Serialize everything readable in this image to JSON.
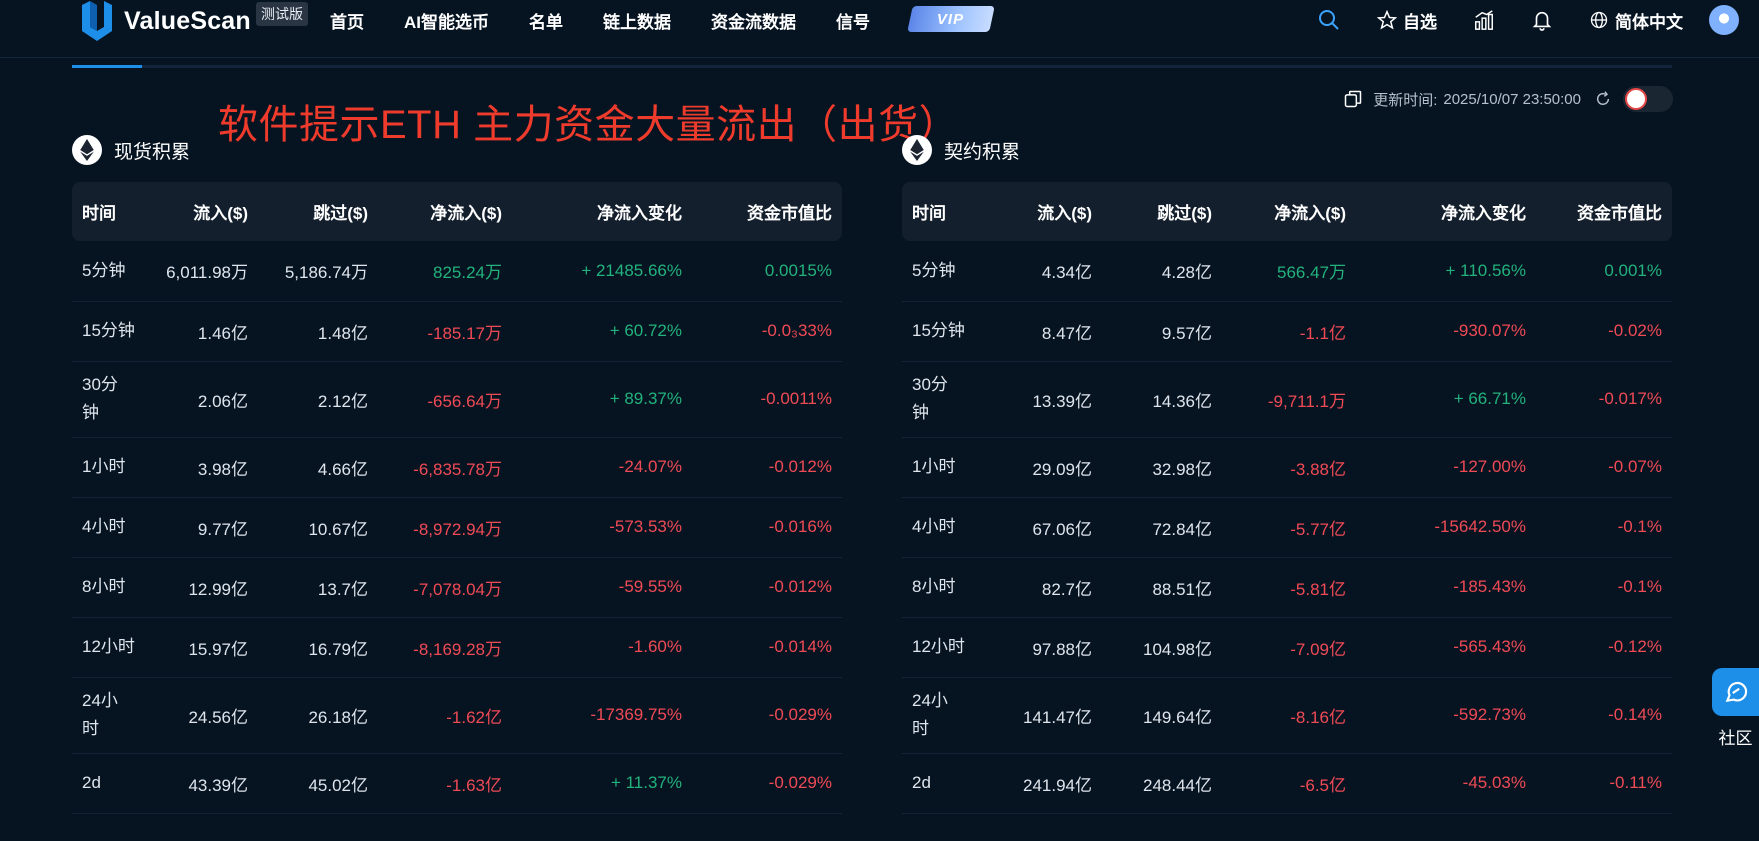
{
  "header": {
    "logo_text": "ValueScan",
    "beta_badge": "测试版",
    "nav": [
      "首页",
      "AI智能选币",
      "名单",
      "链上数据",
      "资金流数据",
      "信号"
    ],
    "vip_label": "VIP",
    "watchlist_label": "自选",
    "language_label": "简体中文"
  },
  "overlay_caption": "软件提示ETH 主力资金大量流出（出货）",
  "update": {
    "label": "更新时间:",
    "time": "2025/10/07 23:50:00"
  },
  "colors": {
    "accent": "#1e8fe8",
    "positive": "#23b27c",
    "negative": "#f04a55",
    "caption": "#ee3b2c"
  },
  "spot": {
    "title": "现货积累",
    "columns": [
      "时间",
      "流入($)",
      "跳过($)",
      "净流入($)",
      "净流入变化",
      "资金市值比"
    ],
    "rows": [
      {
        "period": "5分钟",
        "inflow": "6,011.98万",
        "skip": "5,186.74万",
        "net": "825.24万",
        "change": "+ 21485.66%",
        "ratio": "0.0015%",
        "net_sign": "pos",
        "change_sign": "pos",
        "ratio_sign": "pos"
      },
      {
        "period": "15分钟",
        "inflow": "1.46亿",
        "skip": "1.48亿",
        "net": "-185.17万",
        "change": "+ 60.72%",
        "ratio": "-0.0₃33%",
        "net_sign": "neg",
        "change_sign": "pos",
        "ratio_sign": "neg"
      },
      {
        "period": "30分\n钟",
        "inflow": "2.06亿",
        "skip": "2.12亿",
        "net": "-656.64万",
        "change": "+ 89.37%",
        "ratio": "-0.0011%",
        "net_sign": "neg",
        "change_sign": "pos",
        "ratio_sign": "neg",
        "tall": true
      },
      {
        "period": "1小时",
        "inflow": "3.98亿",
        "skip": "4.66亿",
        "net": "-6,835.78万",
        "change": "-24.07%",
        "ratio": "-0.012%",
        "net_sign": "neg",
        "change_sign": "neg",
        "ratio_sign": "neg"
      },
      {
        "period": "4小时",
        "inflow": "9.77亿",
        "skip": "10.67亿",
        "net": "-8,972.94万",
        "change": "-573.53%",
        "ratio": "-0.016%",
        "net_sign": "neg",
        "change_sign": "neg",
        "ratio_sign": "neg"
      },
      {
        "period": "8小时",
        "inflow": "12.99亿",
        "skip": "13.7亿",
        "net": "-7,078.04万",
        "change": "-59.55%",
        "ratio": "-0.012%",
        "net_sign": "neg",
        "change_sign": "neg",
        "ratio_sign": "neg"
      },
      {
        "period": "12小时",
        "inflow": "15.97亿",
        "skip": "16.79亿",
        "net": "-8,169.28万",
        "change": "-1.60%",
        "ratio": "-0.014%",
        "net_sign": "neg",
        "change_sign": "neg",
        "ratio_sign": "neg"
      },
      {
        "period": "24小\n时",
        "inflow": "24.56亿",
        "skip": "26.18亿",
        "net": "-1.62亿",
        "change": "-17369.75%",
        "ratio": "-0.029%",
        "net_sign": "neg",
        "change_sign": "neg",
        "ratio_sign": "neg",
        "tall": true
      },
      {
        "period": "2d",
        "inflow": "43.39亿",
        "skip": "45.02亿",
        "net": "-1.63亿",
        "change": "+ 11.37%",
        "ratio": "-0.029%",
        "net_sign": "neg",
        "change_sign": "pos",
        "ratio_sign": "neg"
      }
    ]
  },
  "futures": {
    "title": "契约积累",
    "columns": [
      "时间",
      "流入($)",
      "跳过($)",
      "净流入($)",
      "净流入变化",
      "资金市值比"
    ],
    "rows": [
      {
        "period": "5分钟",
        "inflow": "4.34亿",
        "skip": "4.28亿",
        "net": "566.47万",
        "change": "+ 110.56%",
        "ratio": "0.001%",
        "net_sign": "pos",
        "change_sign": "pos",
        "ratio_sign": "pos"
      },
      {
        "period": "15分钟",
        "inflow": "8.47亿",
        "skip": "9.57亿",
        "net": "-1.1亿",
        "change": "-930.07%",
        "ratio": "-0.02%",
        "net_sign": "neg",
        "change_sign": "neg",
        "ratio_sign": "neg"
      },
      {
        "period": "30分\n钟",
        "inflow": "13.39亿",
        "skip": "14.36亿",
        "net": "-9,711.1万",
        "change": "+ 66.71%",
        "ratio": "-0.017%",
        "net_sign": "neg",
        "change_sign": "pos",
        "ratio_sign": "neg",
        "tall": true
      },
      {
        "period": "1小时",
        "inflow": "29.09亿",
        "skip": "32.98亿",
        "net": "-3.88亿",
        "change": "-127.00%",
        "ratio": "-0.07%",
        "net_sign": "neg",
        "change_sign": "neg",
        "ratio_sign": "neg"
      },
      {
        "period": "4小时",
        "inflow": "67.06亿",
        "skip": "72.84亿",
        "net": "-5.77亿",
        "change": "-15642.50%",
        "ratio": "-0.1%",
        "net_sign": "neg",
        "change_sign": "neg",
        "ratio_sign": "neg"
      },
      {
        "period": "8小时",
        "inflow": "82.7亿",
        "skip": "88.51亿",
        "net": "-5.81亿",
        "change": "-185.43%",
        "ratio": "-0.1%",
        "net_sign": "neg",
        "change_sign": "neg",
        "ratio_sign": "neg"
      },
      {
        "period": "12小时",
        "inflow": "97.88亿",
        "skip": "104.98亿",
        "net": "-7.09亿",
        "change": "-565.43%",
        "ratio": "-0.12%",
        "net_sign": "neg",
        "change_sign": "neg",
        "ratio_sign": "neg"
      },
      {
        "period": "24小\n时",
        "inflow": "141.47亿",
        "skip": "149.64亿",
        "net": "-8.16亿",
        "change": "-592.73%",
        "ratio": "-0.14%",
        "net_sign": "neg",
        "change_sign": "neg",
        "ratio_sign": "neg",
        "tall": true
      },
      {
        "period": "2d",
        "inflow": "241.94亿",
        "skip": "248.44亿",
        "net": "-6.5亿",
        "change": "-45.03%",
        "ratio": "-0.11%",
        "net_sign": "neg",
        "change_sign": "neg",
        "ratio_sign": "neg"
      }
    ]
  },
  "community_label": "社区"
}
